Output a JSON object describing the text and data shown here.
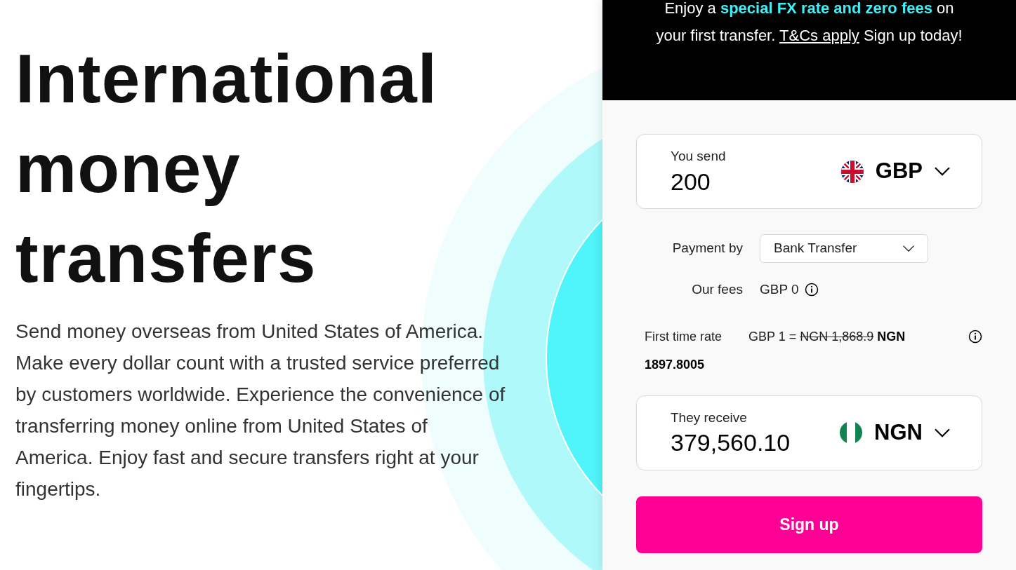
{
  "hero": {
    "headline": [
      "International",
      "money",
      "transfers"
    ],
    "description": "Send money overseas from United States of America. Make every dollar count with a trusted service preferred by customers worldwide. Experience the convenience of transferring money online from United States of America. Enjoy fast and secure transfers right at your fingertips."
  },
  "banner": {
    "text": "Enjoy a **special FX rate and zero fees** on your first transfer.",
    "link": "T&Cs apply",
    "after": "Sign up today!"
  },
  "send": {
    "label": "You send",
    "value": "200",
    "currency": "GBP",
    "kind": "uk"
  },
  "payment": {
    "label": "Payment by",
    "value": "Bank Transfer"
  },
  "fees": {
    "label": "Our fees",
    "value": "GBP 0"
  },
  "rate": {
    "label": "First time rate",
    "prefix": "GBP 1 =",
    "old": "NGN 1,868.9",
    "new": "NGN 1897.8005"
  },
  "receive": {
    "label": "They receive",
    "value": "379,560.10",
    "currency": "NGN",
    "kind": "ng"
  },
  "cta": "Sign up"
}
